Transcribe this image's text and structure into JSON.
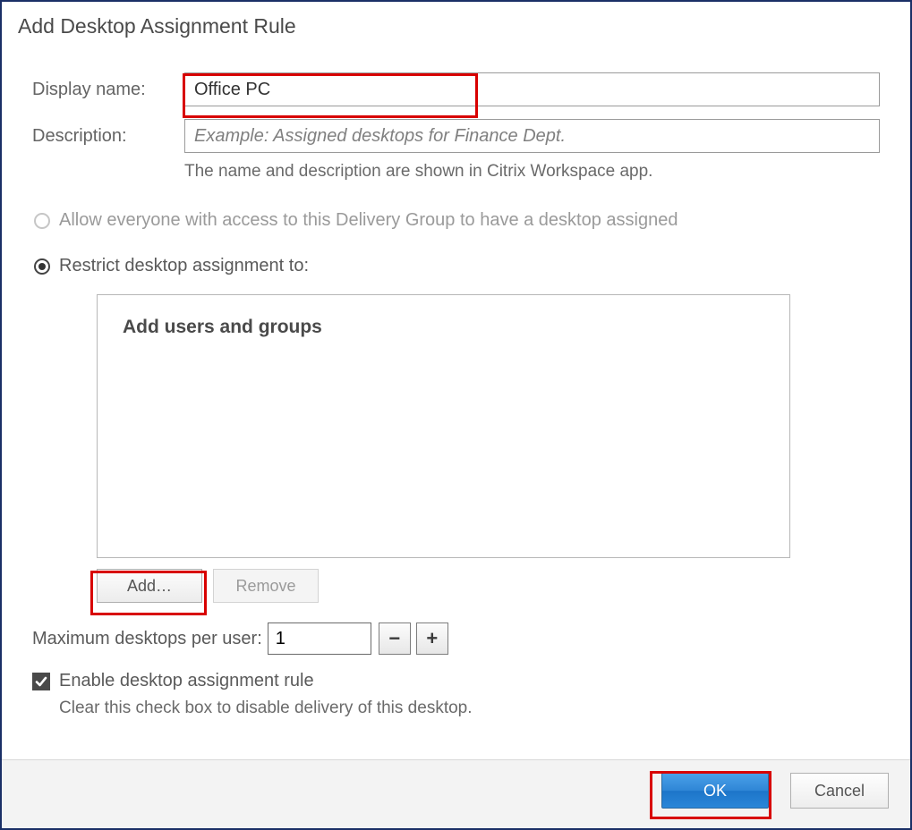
{
  "window": {
    "title": "Add Desktop Assignment Rule"
  },
  "fields": {
    "displayName": {
      "label": "Display name:",
      "value": "Office PC"
    },
    "description": {
      "label": "Description:",
      "placeholder": "Example: Assigned desktops for Finance Dept."
    },
    "hint": "The name and description are shown in Citrix Workspace app."
  },
  "radios": {
    "allowEveryone": "Allow everyone with access to this Delivery Group to have a desktop assigned",
    "restrictTo": "Restrict desktop assignment to:"
  },
  "usersBox": {
    "heading": "Add users and groups"
  },
  "buttons": {
    "add": "Add…",
    "remove": "Remove",
    "ok": "OK",
    "cancel": "Cancel"
  },
  "maxDesktops": {
    "label": "Maximum desktops per user:",
    "value": "1",
    "minus": "−",
    "plus": "+"
  },
  "enableRule": {
    "label": "Enable desktop assignment rule",
    "hint": "Clear this check box to disable delivery of this desktop."
  }
}
